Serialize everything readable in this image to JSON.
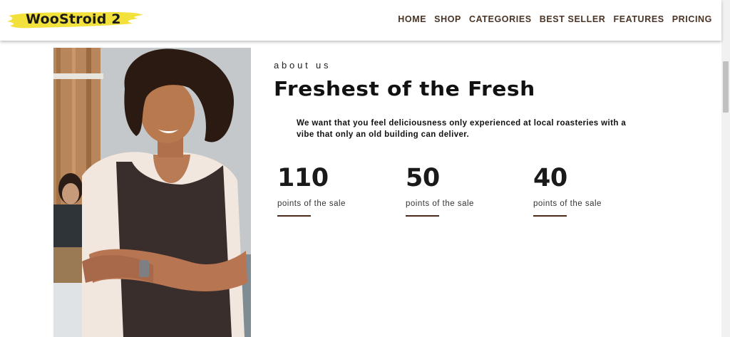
{
  "header": {
    "logo_text": "WooStroid 2",
    "nav": [
      "HOME",
      "SHOP",
      "CATEGORIES",
      "BEST SELLER",
      "FEATURES",
      "PRICING"
    ]
  },
  "about": {
    "label": "about us",
    "heading": "Freshest of the Fresh",
    "description": "We want that you feel deliciousness only experienced at local roasteries with a vibe that only an old building can deliver."
  },
  "stats": [
    {
      "value": "110",
      "label": "points of the sale"
    },
    {
      "value": "50",
      "label": "points of the sale"
    },
    {
      "value": "40",
      "label": "points of the sale"
    }
  ],
  "colors": {
    "accent_brown": "#4a2a1a",
    "logo_highlight": "#f3e13b",
    "nav_text": "#4a3426"
  }
}
